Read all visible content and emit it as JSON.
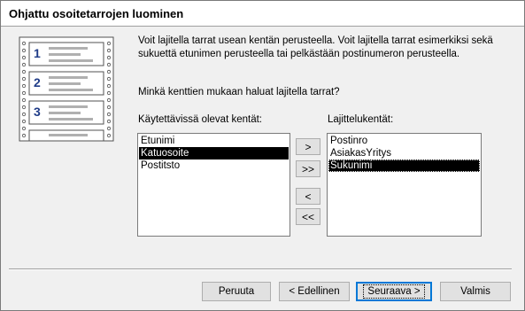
{
  "window": {
    "title": "Ohjattu osoitetarrojen luominen"
  },
  "illustration": {
    "numbers": [
      "1",
      "2",
      "3"
    ]
  },
  "description": "Voit lajitella tarrat usean kentän perusteella. Voit lajitella tarrat esimerkiksi sekä sukuettä etunimen perusteella tai pelkästään postinumeron perusteella.",
  "question": "Minkä kenttien mukaan haluat lajitella tarrat?",
  "available": {
    "label": "Käytettävissä olevat kentät:",
    "items": [
      "Etunimi",
      "Katuosoite",
      "Postitsto"
    ],
    "selected": "Katuosoite"
  },
  "sort": {
    "label": "Lajittelukentät:",
    "items": [
      "Postinro",
      "AsiakasYritys",
      "Sukunimi"
    ],
    "selected": "Sukunimi"
  },
  "move_buttons": {
    "add_one": ">",
    "add_all": ">>",
    "remove_one": "<",
    "remove_all": "<<"
  },
  "buttons": {
    "cancel": "Peruuta",
    "back": "< Edellinen",
    "next": "Seuraava >",
    "finish": "Valmis"
  }
}
